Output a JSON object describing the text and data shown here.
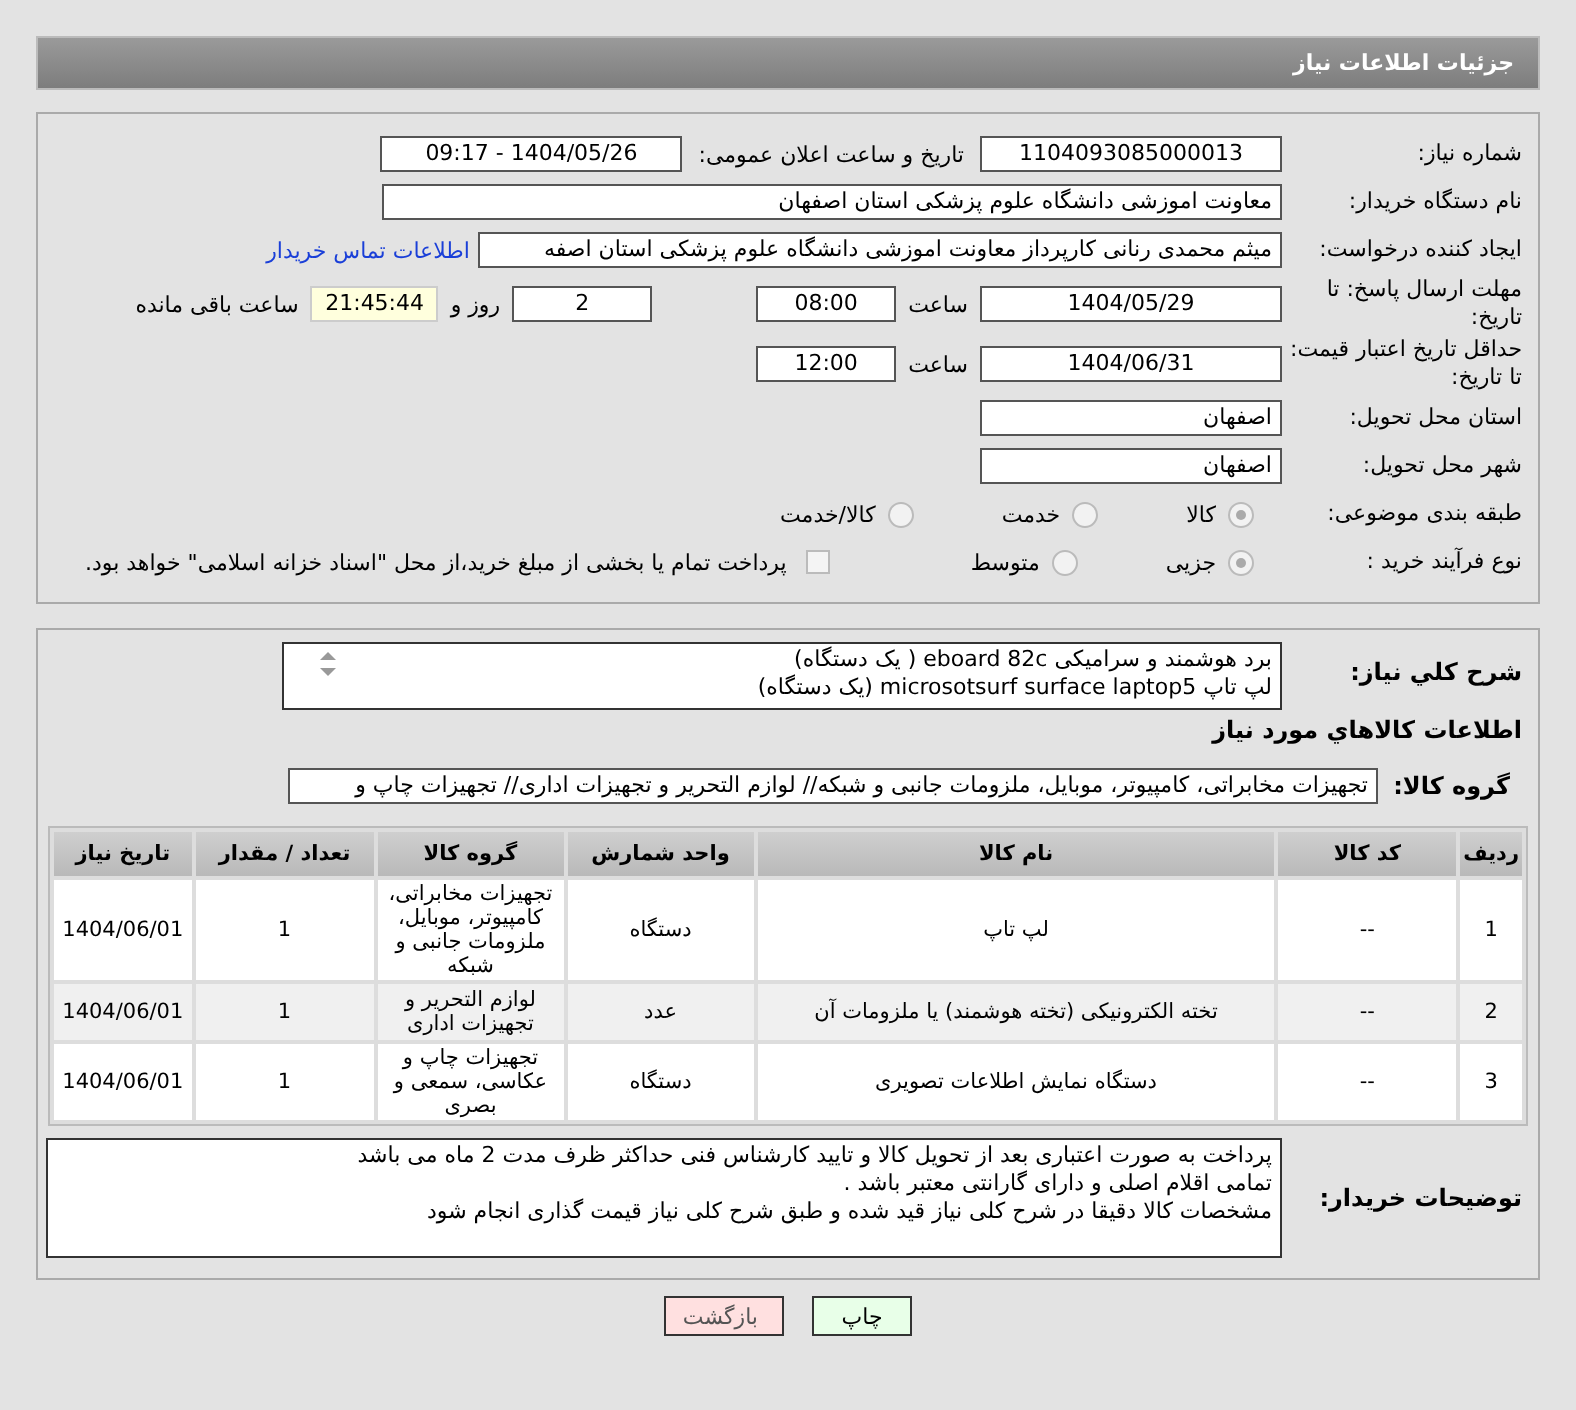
{
  "header": {
    "title": "جزئیات اطلاعات نیاز"
  },
  "need_number": {
    "label": "شماره نیاز:",
    "value": "1104093085000013"
  },
  "announce": {
    "label": "تاریخ و ساعت اعلان عمومی:",
    "value": "1404/05/26 - 09:17"
  },
  "buyer_org": {
    "label": "نام دستگاه خریدار:",
    "value": "معاونت اموزشی دانشگاه علوم پزشکی استان اصفهان"
  },
  "requester": {
    "label": "ایجاد کننده درخواست:",
    "value": "میثم محمدی رنانی کارپرداز معاونت اموزشی دانشگاه علوم پزشکی استان اصفه",
    "link": "اطلاعات تماس خریدار"
  },
  "deadline": {
    "label": "مهلت ارسال پاسخ: تا تاریخ:",
    "date": "1404/05/29",
    "time_label": "ساعت",
    "time": "08:00",
    "days": "2",
    "days_label": "روز و",
    "remaining": "21:45:44",
    "remaining_label": "ساعت باقی مانده"
  },
  "validity": {
    "label": "حداقل تاریخ اعتبار قیمت: تا تاریخ:",
    "date": "1404/06/31",
    "time_label": "ساعت",
    "time": "12:00"
  },
  "province": {
    "label": "استان محل تحویل:",
    "value": "اصفهان"
  },
  "city": {
    "label": "شهر محل تحویل:",
    "value": "اصفهان"
  },
  "category": {
    "label": "طبقه بندی موضوعی:",
    "options": [
      {
        "label": "کالا",
        "selected": true
      },
      {
        "label": "خدمت",
        "selected": false
      },
      {
        "label": "کالا/خدمت",
        "selected": false
      }
    ]
  },
  "process": {
    "label": "نوع فرآیند خرید :",
    "options": [
      {
        "label": "جزیی",
        "selected": true
      },
      {
        "label": "متوسط",
        "selected": false
      }
    ],
    "treasury": {
      "checked": false,
      "label": "پرداخت تمام یا بخشی از مبلغ خرید،از محل \"اسناد خزانه اسلامی\" خواهد بود."
    }
  },
  "description": {
    "label": "شرح کلي نياز:",
    "lines": [
      "برد هوشمند و سرامیکی eboard 82c ( یک دستگاه)",
      "لپ تاپ microsotsurf surface laptop5 (یک دستگاه)"
    ]
  },
  "goods_heading": "اطلاعات کالاهاي مورد نياز",
  "goods_group": {
    "label": "گروه کالا:",
    "value": "تجهیزات مخابراتی، کامپیوتر، موبایل، ملزومات جانبی و شبکه// لوازم التحریر و تجهیزات اداری// تجهیزات چاپ و"
  },
  "table": {
    "columns": [
      "ردیف",
      "کد کالا",
      "نام کالا",
      "واحد شمارش",
      "گروه کالا",
      "تعداد / مقدار",
      "تاریخ نیاز"
    ],
    "rows": [
      [
        "1",
        "--",
        "لپ تاپ",
        "دستگاه",
        "تجهیزات مخابراتی، کامپیوتر، موبایل، ملزومات جانبی و شبکه",
        "1",
        "1404/06/01"
      ],
      [
        "2",
        "--",
        "تخته الکترونیکی (تخته هوشمند) یا ملزومات آن",
        "عدد",
        "لوازم التحریر و تجهیزات اداری",
        "1",
        "1404/06/01"
      ],
      [
        "3",
        "--",
        "دستگاه نمایش اطلاعات تصویری",
        "دستگاه",
        "تجهیزات چاپ و عکاسی، سمعی و بصری",
        "1",
        "1404/06/01"
      ]
    ]
  },
  "buyer_notes": {
    "label": "توضیحات خریدار:",
    "lines": [
      "پرداخت به صورت اعتباری بعد از تحویل کالا و تایید کارشناس فنی حداکثر ظرف مدت 2 ماه می باشد",
      "تمامی اقلام اصلی و دارای گارانتی معتبر باشد .",
      "مشخصات کالا دقیقا در شرح کلی نیاز قید شده و طبق شرح کلی نیاز قیمت گذاری انجام شود"
    ]
  },
  "buttons": [
    {
      "kind": "print",
      "label": "چاپ"
    },
    {
      "kind": "back",
      "label": "بازگشت"
    }
  ]
}
